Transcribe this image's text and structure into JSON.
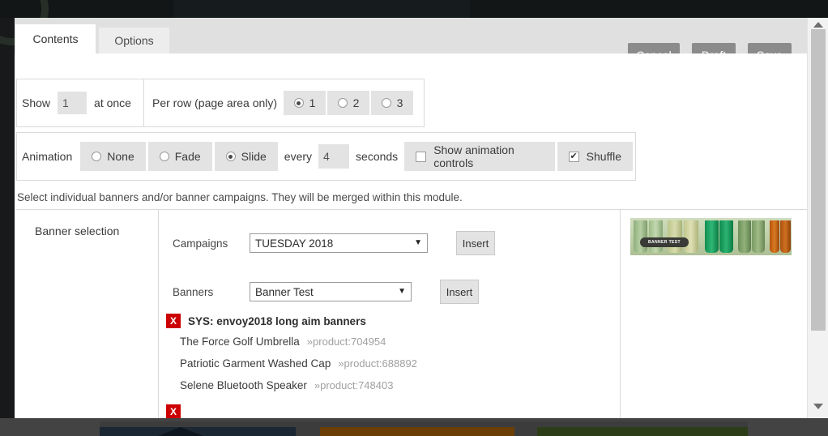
{
  "window": {
    "tabs": [
      {
        "label": "Contents",
        "active": true
      },
      {
        "label": "Options",
        "active": false
      }
    ],
    "actions": {
      "cancel": "Cancel",
      "draft": "Draft",
      "save": "Save"
    },
    "button_color": "#8b8b8b"
  },
  "settings": {
    "show": {
      "label": "Show",
      "value": "1",
      "suffix": "at once"
    },
    "per_row": {
      "label": "Per row (page area only)",
      "options": [
        {
          "label": "1",
          "selected": true
        },
        {
          "label": "2",
          "selected": false
        },
        {
          "label": "3",
          "selected": false
        }
      ]
    },
    "animation": {
      "label": "Animation",
      "options": [
        {
          "label": "None",
          "selected": false
        },
        {
          "label": "Fade",
          "selected": false
        },
        {
          "label": "Slide",
          "selected": true
        }
      ],
      "every_label": "every",
      "seconds_value": "4",
      "seconds_label": "seconds",
      "show_controls": {
        "label": "Show animation controls",
        "checked": false
      },
      "shuffle": {
        "label": "Shuffle",
        "checked": true
      }
    }
  },
  "description": "Select individual banners and/or banner campaigns. They will be merged within this module.",
  "banner_selection": {
    "title": "Banner selection",
    "campaigns": {
      "label": "Campaigns",
      "selected": "TUESDAY 2018",
      "insert_label": "Insert"
    },
    "banners": {
      "label": "Banners",
      "selected": "Banner Test",
      "insert_label": "Insert"
    },
    "remove_label": "X",
    "list": {
      "group_title": "SYS: envoy2018 long aim banners",
      "items": [
        {
          "name": "The Force Golf Umbrella",
          "ref": "»product:704954"
        },
        {
          "name": "Patriotic Garment Washed Cap",
          "ref": "»product:688892"
        },
        {
          "name": "Selene Bluetooth Speaker",
          "ref": "»product:748403"
        }
      ]
    },
    "preview": {
      "badge_text": "BANNER TEST"
    }
  },
  "colors": {
    "remove_button": "#cc0000",
    "selected_radio": "#4a4a4a",
    "control_bg": "#e3e3e3"
  }
}
